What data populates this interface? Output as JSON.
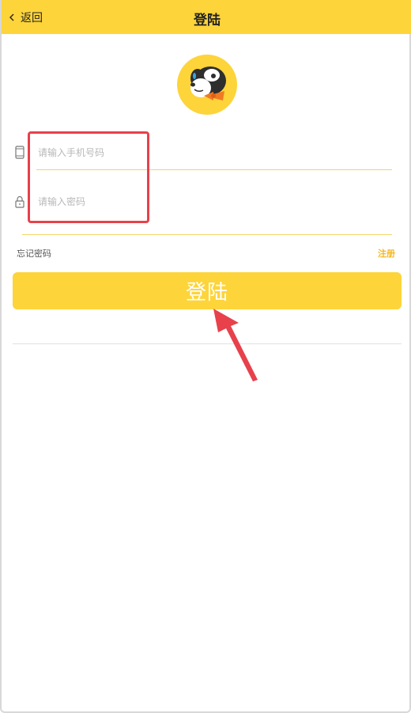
{
  "header": {
    "back_label": "返回",
    "title": "登陆",
    "background": "#fdd43a"
  },
  "avatar": {
    "icon": "mascot-avatar"
  },
  "form": {
    "phone_placeholder": "请输入手机号码",
    "phone_value": "",
    "password_placeholder": "请输入密码",
    "password_value": ""
  },
  "links": {
    "forgot_password": "忘记密码",
    "register": "注册"
  },
  "login_button": {
    "label": "登陆"
  },
  "colors": {
    "accent": "#fdd43a",
    "annotation": "#e8414b",
    "register_link": "#f5b820"
  }
}
